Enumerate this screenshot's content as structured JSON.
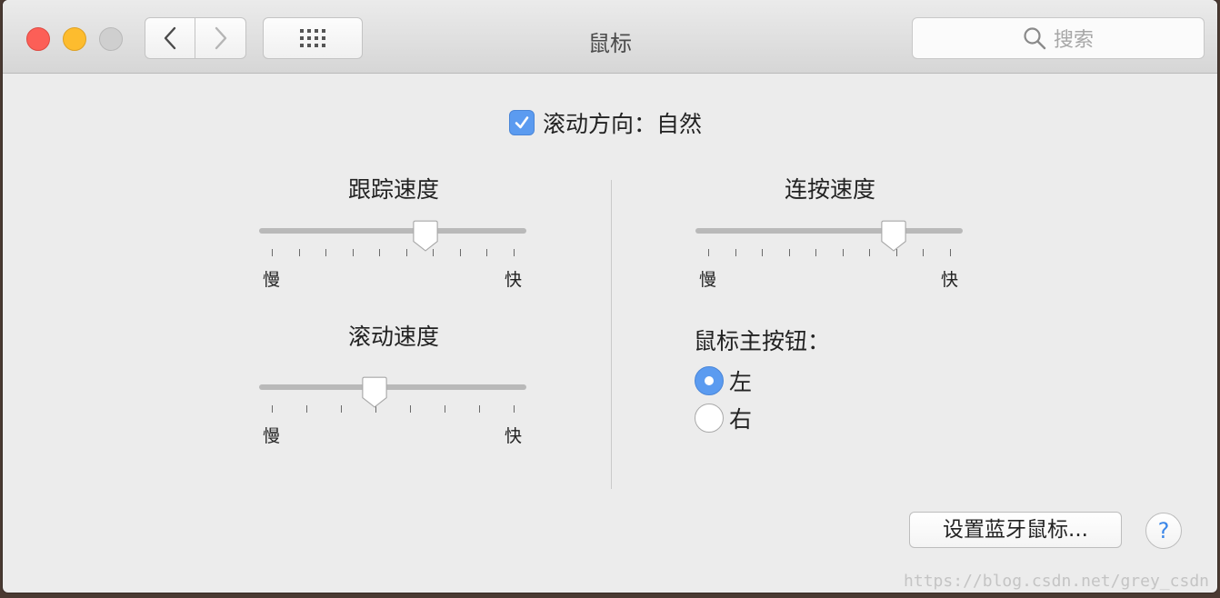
{
  "window": {
    "title": "鼠标"
  },
  "toolbar": {
    "search_placeholder": "搜索"
  },
  "scroll_direction": {
    "label": "滚动方向：自然",
    "checked": true
  },
  "tracking_speed": {
    "title": "跟踪速度",
    "min_label": "慢",
    "max_label": "快",
    "value": 0.64
  },
  "scroll_speed": {
    "title": "滚动速度",
    "min_label": "慢",
    "max_label": "快",
    "value": 0.43
  },
  "double_click_speed": {
    "title": "连按速度",
    "min_label": "慢",
    "max_label": "快",
    "value": 0.77
  },
  "primary_button": {
    "label": "鼠标主按钮：",
    "options": [
      {
        "label": "左",
        "selected": true
      },
      {
        "label": "右",
        "selected": false
      }
    ]
  },
  "bluetooth_button": {
    "label": "设置蓝牙鼠标..."
  },
  "help_button": {
    "label": "?"
  },
  "watermark": "https://blog.csdn.net/grey_csdn",
  "colors": {
    "accent": "#5b9bf0",
    "close": "#fc5f57",
    "minimize": "#fdbc2e",
    "zoom": "#cfcfcf"
  }
}
